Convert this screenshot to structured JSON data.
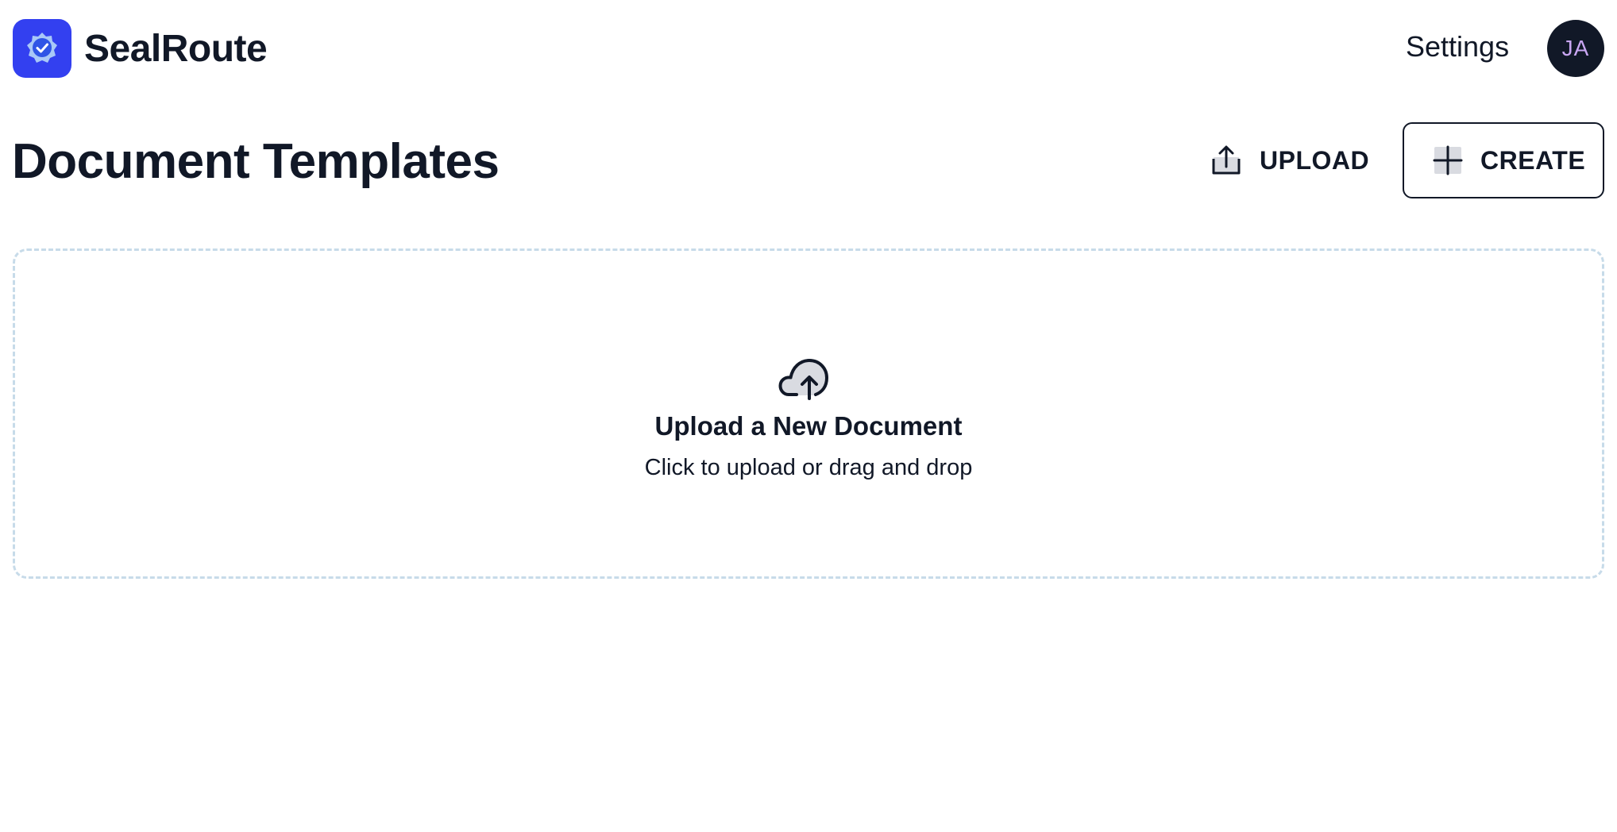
{
  "app": {
    "name": "SealRoute",
    "logo_icon": "shield-check-icon",
    "brand_color": "#3340f0"
  },
  "nav": {
    "settings_label": "Settings",
    "avatar_initials": "JA"
  },
  "page": {
    "title": "Document Templates"
  },
  "actions": {
    "upload_label": "UPLOAD",
    "upload_icon": "upload-icon",
    "create_label": "CREATE",
    "create_icon": "plus-icon"
  },
  "dropzone": {
    "icon": "cloud-upload-icon",
    "title": "Upload a New Document",
    "subtitle": "Click to upload or drag and drop",
    "border_color": "#c7dbe9"
  }
}
